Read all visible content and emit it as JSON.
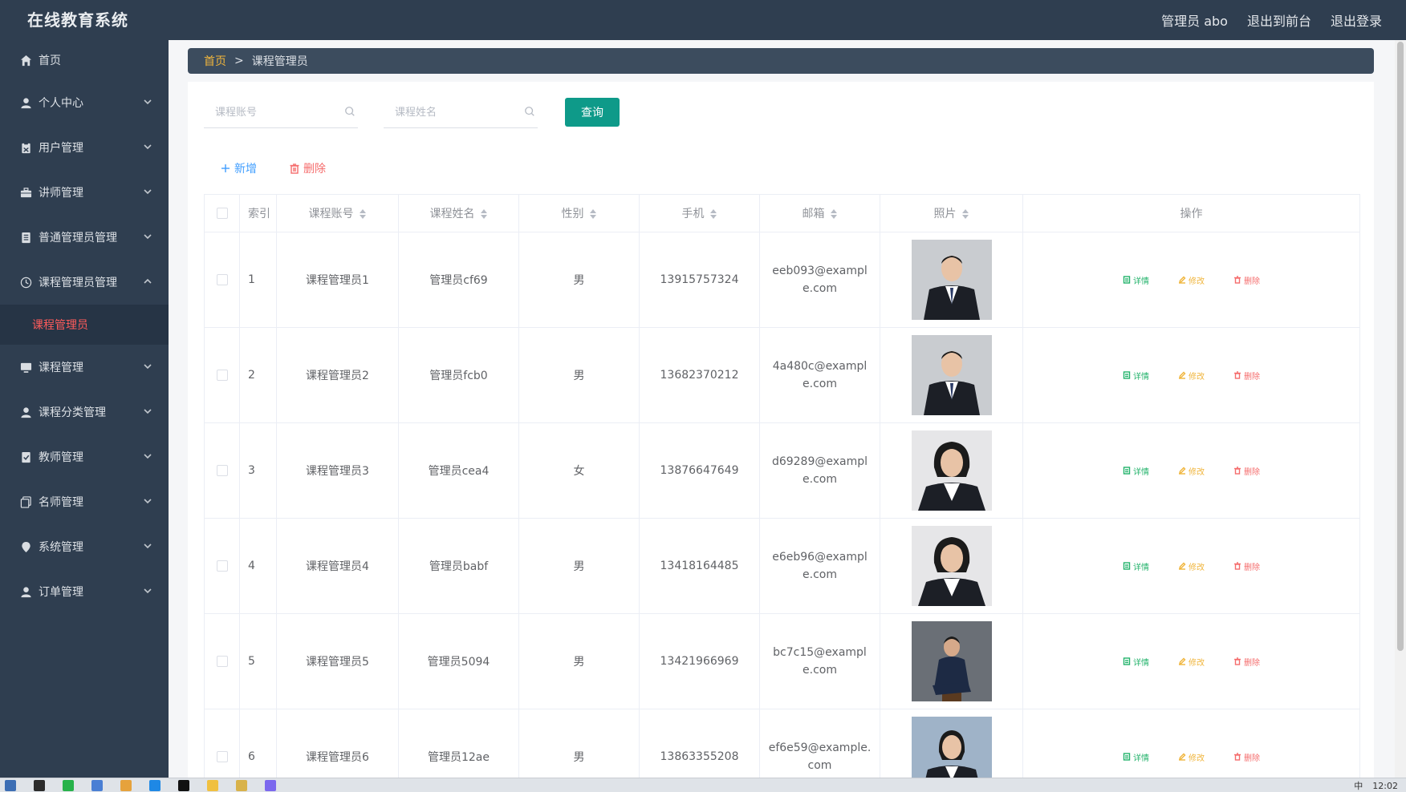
{
  "header": {
    "app_title": "在线教育系统",
    "user_label": "管理员 abo",
    "front_link": "退出到前台",
    "logout_link": "退出登录"
  },
  "sidebar": {
    "items": [
      {
        "label": "首页",
        "icon": "home-icon",
        "expandable": false
      },
      {
        "label": "个人中心",
        "icon": "user-icon",
        "expandable": true
      },
      {
        "label": "用户管理",
        "icon": "clipboard-icon",
        "expandable": true
      },
      {
        "label": "讲师管理",
        "icon": "briefcase-icon",
        "expandable": true
      },
      {
        "label": "普通管理员管理",
        "icon": "list-icon",
        "expandable": true
      },
      {
        "label": "课程管理员管理",
        "icon": "clock-icon",
        "expandable": true,
        "expanded": true
      },
      {
        "label": "课程管理",
        "icon": "monitor-icon",
        "expandable": true
      },
      {
        "label": "课程分类管理",
        "icon": "user-icon",
        "expandable": true
      },
      {
        "label": "教师管理",
        "icon": "checklist-icon",
        "expandable": true
      },
      {
        "label": "名师管理",
        "icon": "copy-icon",
        "expandable": true
      },
      {
        "label": "系统管理",
        "icon": "pin-icon",
        "expandable": true
      },
      {
        "label": "订单管理",
        "icon": "user-icon",
        "expandable": true
      }
    ],
    "active_sub": "课程管理员"
  },
  "breadcrumb": {
    "home": "首页",
    "separator": ">",
    "current": "课程管理员"
  },
  "search": {
    "account_placeholder": "课程账号",
    "name_placeholder": "课程姓名",
    "query_button": "查询"
  },
  "actions": {
    "add_label": "新增",
    "delete_label": "删除"
  },
  "table": {
    "columns": [
      "索引",
      "课程账号",
      "课程姓名",
      "性别",
      "手机",
      "邮箱",
      "照片",
      "操作"
    ],
    "sortable": [
      false,
      true,
      true,
      true,
      true,
      true,
      true,
      false
    ],
    "rows": [
      {
        "index": "1",
        "account": "课程管理员1",
        "name": "管理员cf69",
        "gender": "男",
        "phone": "13915757324",
        "email": "eeb093@example.com",
        "photo": "man-suit-portrait"
      },
      {
        "index": "2",
        "account": "课程管理员2",
        "name": "管理员fcb0",
        "gender": "男",
        "phone": "13682370212",
        "email": "4a480c@example.com",
        "photo": "man-suit-portrait"
      },
      {
        "index": "3",
        "account": "课程管理员3",
        "name": "管理员cea4",
        "gender": "女",
        "phone": "13876647649",
        "email": "d69289@example.com",
        "photo": "woman-portrait"
      },
      {
        "index": "4",
        "account": "课程管理员4",
        "name": "管理员babf",
        "gender": "男",
        "phone": "13418164485",
        "email": "e6eb96@example.com",
        "photo": "woman-portrait"
      },
      {
        "index": "5",
        "account": "课程管理员5",
        "name": "管理员5094",
        "gender": "男",
        "phone": "13421966969",
        "email": "bc7c15@example.com",
        "photo": "man-seated-portrait"
      },
      {
        "index": "6",
        "account": "课程管理员6",
        "name": "管理员12ae",
        "gender": "男",
        "phone": "13863355208",
        "email": "ef6e59@example.com",
        "photo": "woman-suit-portrait"
      }
    ],
    "op_labels": {
      "detail": "详情",
      "edit": "修改",
      "remove": "删除"
    }
  },
  "taskbar": {
    "ime": "中",
    "clock": "12:02"
  }
}
